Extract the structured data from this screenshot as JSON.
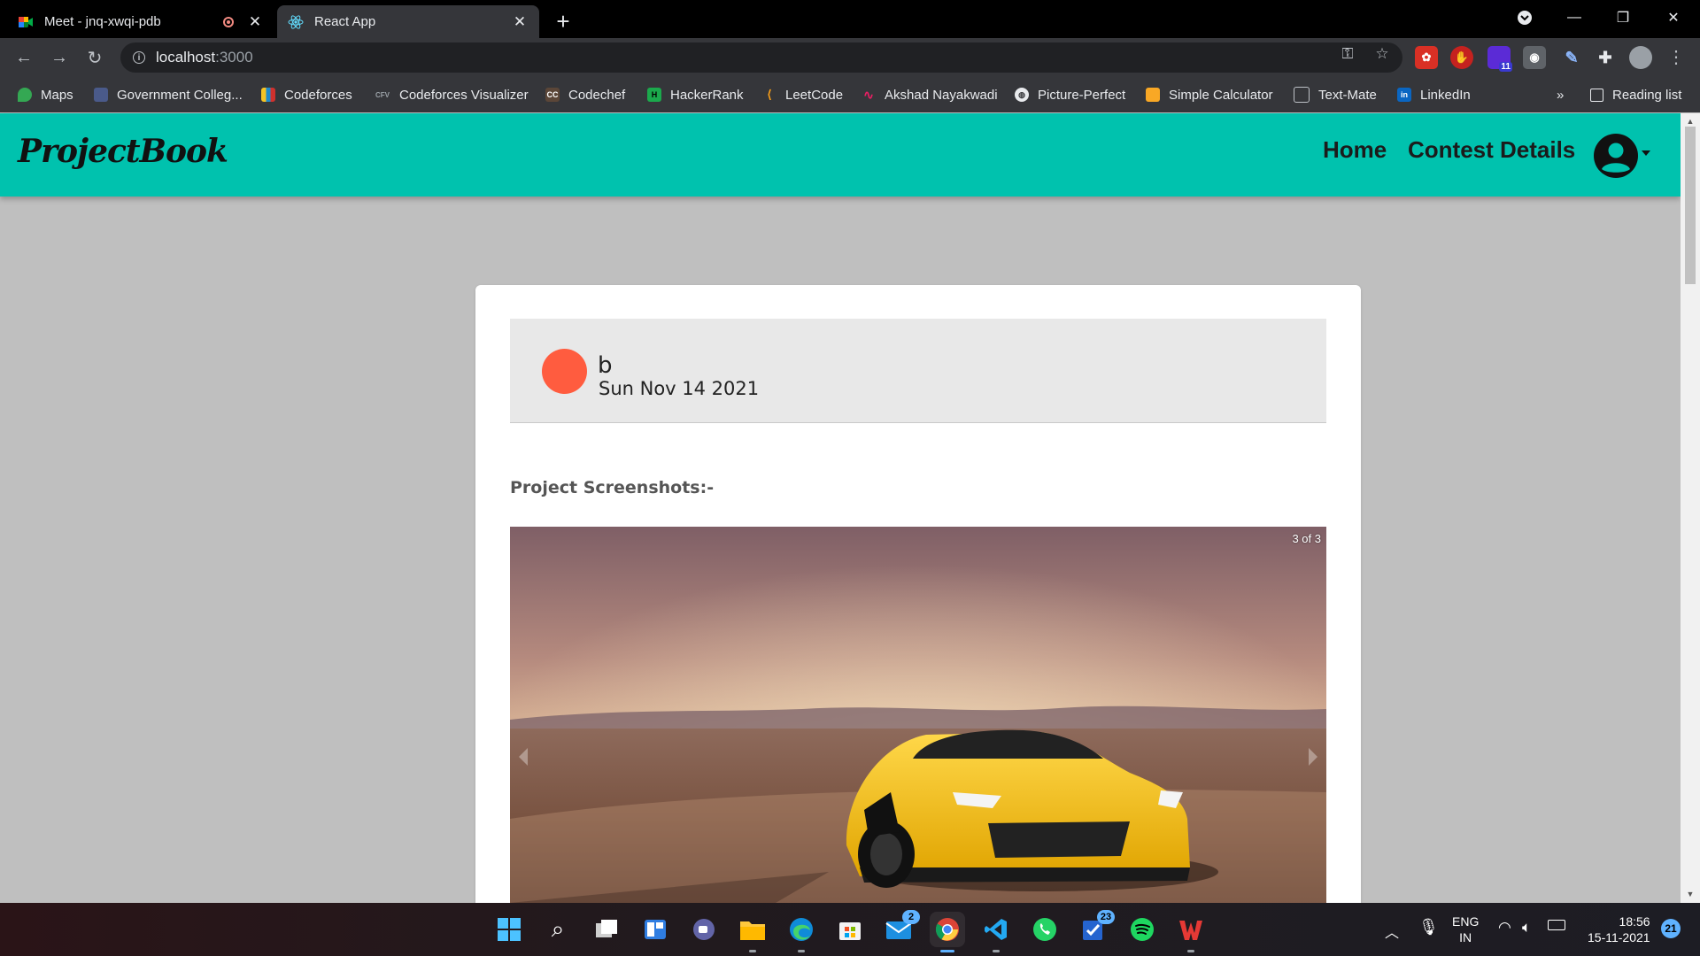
{
  "browser": {
    "tabs": [
      {
        "title": "Meet - jnq-xwqi-pdb",
        "favicon": "google-meet-icon",
        "recording": true
      },
      {
        "title": "React App",
        "favicon": "react-icon",
        "active": true
      }
    ],
    "address": {
      "host": "localhost",
      "port": ":3000"
    },
    "bookmarks": [
      {
        "label": "Maps"
      },
      {
        "label": "Government Colleg..."
      },
      {
        "label": "Codeforces"
      },
      {
        "label": "Codeforces Visualizer"
      },
      {
        "label": "Codechef"
      },
      {
        "label": "HackerRank"
      },
      {
        "label": "LeetCode"
      },
      {
        "label": "Akshad Nayakwadi"
      },
      {
        "label": "Picture-Perfect"
      },
      {
        "label": "Simple Calculator"
      },
      {
        "label": "Text-Mate"
      },
      {
        "label": "LinkedIn"
      }
    ],
    "bookmark_overflow": "»",
    "reading_list": "Reading list",
    "extension_badge": "11"
  },
  "app": {
    "brand": "ProjectBook",
    "nav": {
      "home": "Home",
      "contest": "Contest Details"
    },
    "accent": "#00c2ae",
    "post": {
      "author": "b",
      "date": "Sun Nov 14 2021",
      "avatar_color": "#ff5c3f",
      "screenshots_label": "Project Screenshots:-",
      "carousel_counter": "3 of 3"
    }
  },
  "taskbar": {
    "mail_badge": "2",
    "todo_badge": "23",
    "lang": "ENG",
    "region": "IN",
    "time": "18:56",
    "date": "15-11-2021",
    "notifications": "21"
  }
}
